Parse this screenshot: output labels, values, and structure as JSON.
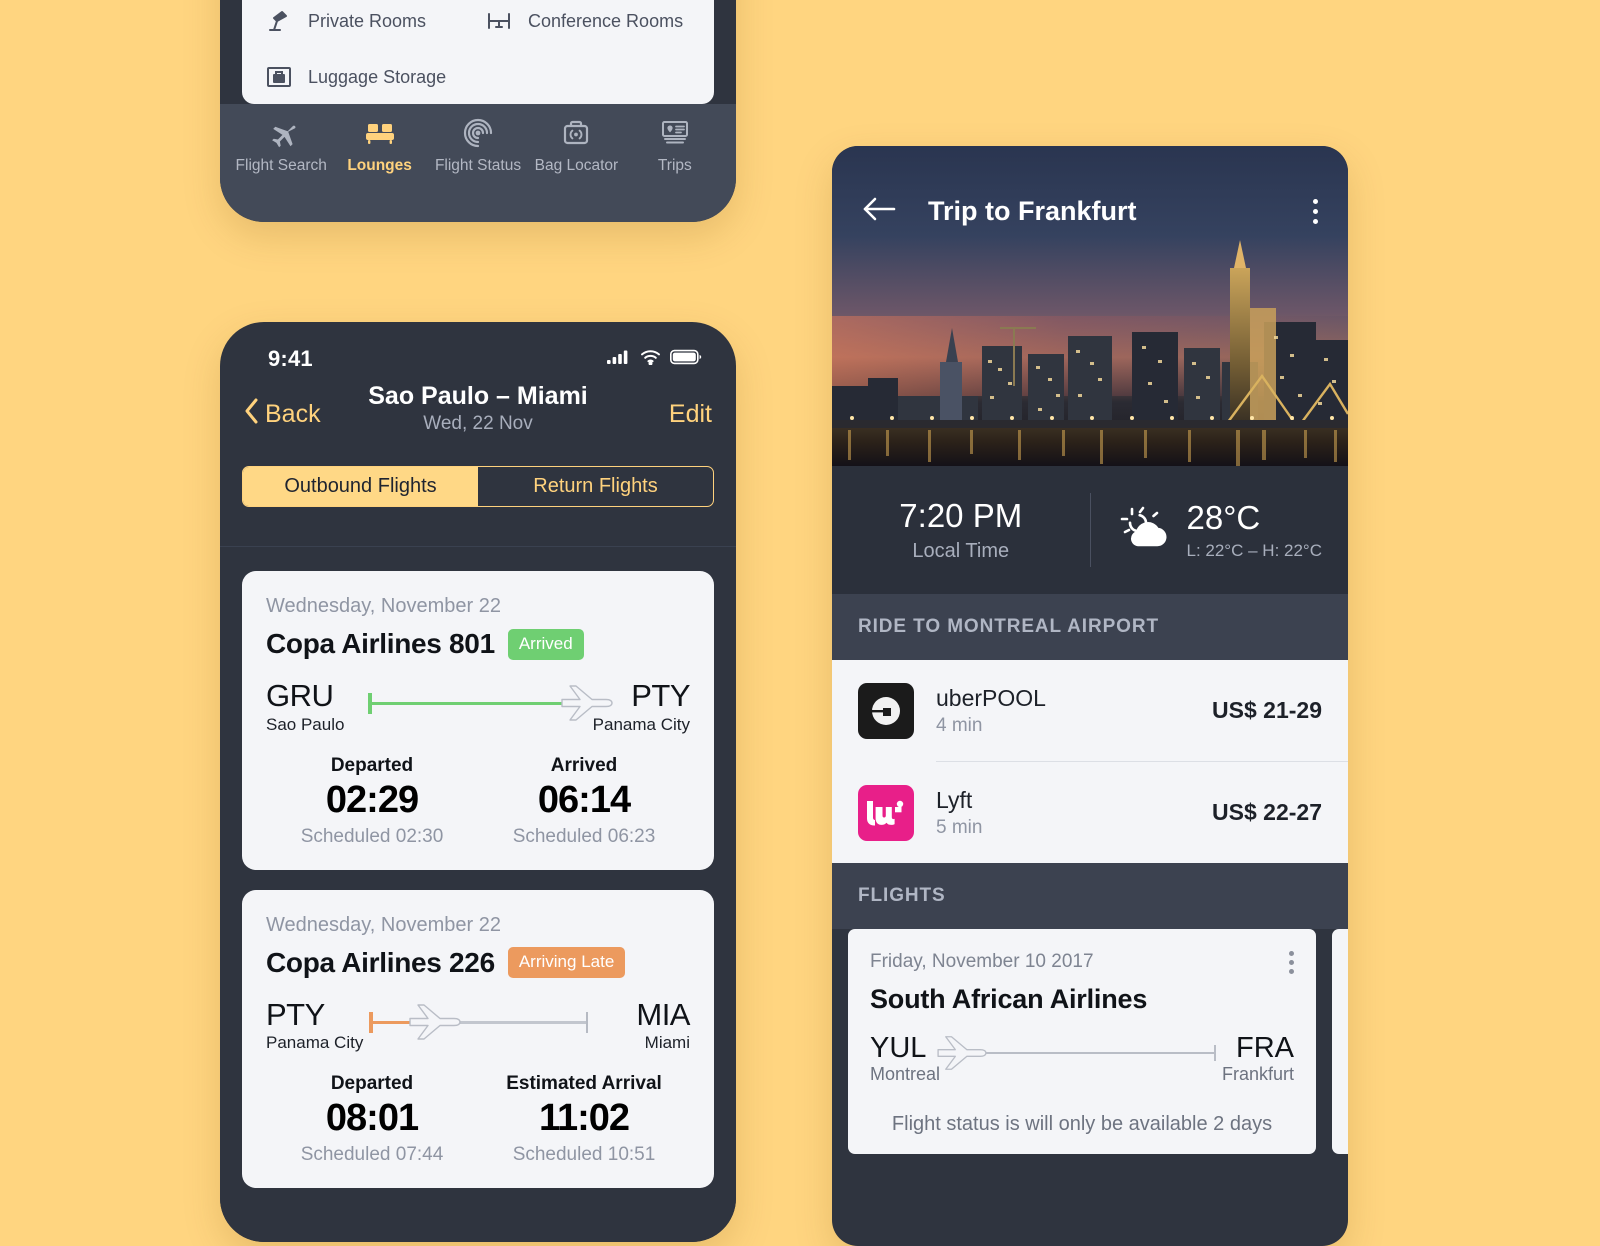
{
  "theme": {
    "background": "#ffd580",
    "device_body": "#2f343f",
    "accent_yellow": "#ffd27d",
    "badge_arrived": "#6fcf72",
    "badge_late": "#ec9a5e",
    "card_surface": "#f4f5f8",
    "uber_black": "#1b1b1b",
    "lyft_pink": "#e81f89"
  },
  "lounges_screen": {
    "amenities": [
      {
        "label": "Private Rooms",
        "icon": "desk-lamp-icon"
      },
      {
        "label": "Conference Rooms",
        "icon": "conference-table-icon"
      },
      {
        "label": "Luggage Storage",
        "icon": "luggage-icon"
      }
    ],
    "tabs": [
      {
        "label": "Flight Search",
        "icon": "airplane-icon",
        "active": false
      },
      {
        "label": "Lounges",
        "icon": "sofa-icon",
        "active": true
      },
      {
        "label": "Flight Status",
        "icon": "radar-icon",
        "active": false
      },
      {
        "label": "Bag Locator",
        "icon": "bag-signal-icon",
        "active": false
      },
      {
        "label": "Trips",
        "icon": "pin-card-icon",
        "active": false
      }
    ]
  },
  "flights_screen": {
    "status_bar": {
      "time": "9:41",
      "signal": "signal-icon",
      "wifi": "wifi-icon",
      "battery": "battery-icon"
    },
    "nav": {
      "back_label": "Back",
      "title": "Sao Paulo – Miami",
      "subtitle": "Wed, 22 Nov",
      "edit_label": "Edit"
    },
    "segments": [
      {
        "label": "Outbound Flights",
        "selected": true
      },
      {
        "label": "Return Flights",
        "selected": false
      }
    ],
    "cards": [
      {
        "date": "Wednesday, November 22",
        "flight": "Copa Airlines 801",
        "status": "Arrived",
        "status_color": "#6fcf72",
        "progress_percent": 100,
        "origin_code": "GRU",
        "origin_city": "Sao Paulo",
        "dest_code": "PTY",
        "dest_city": "Panama City",
        "depart_label": "Departed",
        "depart_time": "02:29",
        "depart_sched": "Scheduled 02:30",
        "arrive_label": "Arrived",
        "arrive_time": "06:14",
        "arrive_sched": "Scheduled 06:23"
      },
      {
        "date": "Wednesday, November 22",
        "flight": "Copa Airlines 226",
        "status": "Arriving Late",
        "status_color": "#ec9a5e",
        "progress_percent": 30,
        "origin_code": "PTY",
        "origin_city": "Panama City",
        "dest_code": "MIA",
        "dest_city": "Miami",
        "depart_label": "Departed",
        "depart_time": "08:01",
        "depart_sched": "Scheduled 07:44",
        "arrive_label": "Estimated Arrival",
        "arrive_time": "11:02",
        "arrive_sched": "Scheduled 10:51"
      }
    ]
  },
  "trip_screen": {
    "hero": {
      "back_icon": "arrow-left-icon",
      "title": "Trip to Frankfurt",
      "overflow_icon": "kebab-menu-icon",
      "photo": "frankfurt-skyline-night-photo"
    },
    "conditions": {
      "time": "7:20 PM",
      "time_label": "Local Time",
      "weather_icon": "sun-behind-cloud-icon",
      "temperature": "28°C",
      "high_low": "L: 22°C – H: 22°C"
    },
    "ride_section": {
      "header": "RIDE TO MONTREAL AIRPORT",
      "options": [
        {
          "provider": "uberPOOL",
          "eta": "4 min",
          "price": "US$ 21-29",
          "logo": "uber-logo-icon"
        },
        {
          "provider": "Lyft",
          "eta": "5 min",
          "price": "US$ 22-27",
          "logo": "lyft-logo-icon"
        }
      ]
    },
    "flights_section": {
      "header": "FLIGHTS",
      "cards": [
        {
          "date": "Friday, November 10 2017",
          "airline": "South African Airlines",
          "origin_code": "YUL",
          "origin_city": "Montreal",
          "dest_code": "FRA",
          "dest_city": "Frankfurt",
          "note": "Flight status is will only be available 2 days",
          "overflow_icon": "kebab-menu-icon"
        }
      ]
    }
  }
}
